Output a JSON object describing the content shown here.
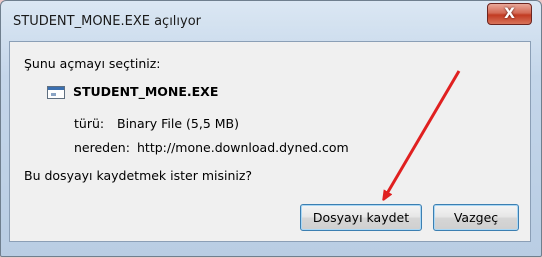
{
  "window": {
    "title": "STUDENT_MONE.EXE açılıyor",
    "close_label": "X"
  },
  "dialog": {
    "prompt": "Şunu açmayı seçtiniz:",
    "file_name": "STUDENT_MONE.EXE",
    "type_label": "türü:",
    "type_value": "Binary File (5,5 MB)",
    "from_label": "nereden:",
    "from_value": "http://mone.download.dyned.com",
    "question": "Bu dosyayı kaydetmek ister misiniz?"
  },
  "buttons": {
    "save": "Dosyayı kaydet",
    "cancel": "Vazgeç"
  },
  "annotation": {
    "arrow_color": "#e02020"
  },
  "colors": {
    "titlebar": "#c4d6ea",
    "close_button": "#c23b22",
    "client_background": "#f0f0f0"
  }
}
